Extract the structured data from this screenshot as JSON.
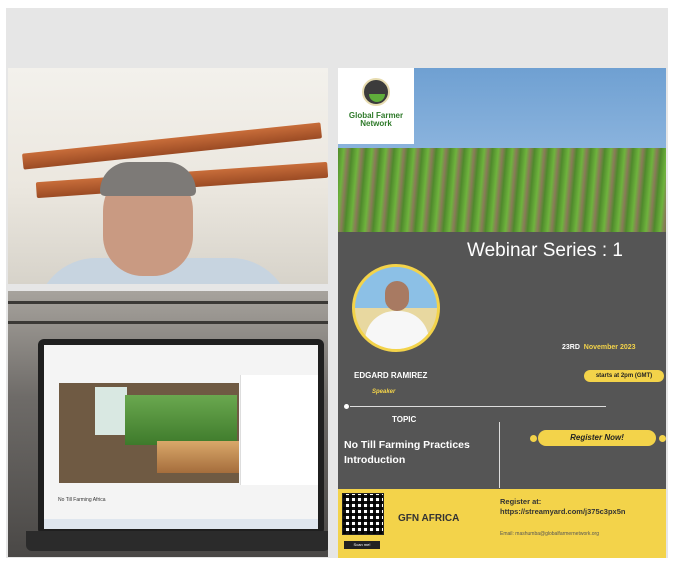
{
  "poster": {
    "logo_text_line1": "Global Farmer",
    "logo_text_line2": "Network",
    "title": "Webinar Series : 1",
    "date_day": "23RD",
    "date_rest": "November 2023",
    "speaker_name": "EDGARD RAMIREZ",
    "speaker_role": "Speaker",
    "starts_at": "starts at 2pm (GMT)",
    "topic_label": "TOPIC",
    "topic_line1": "No Till Farming Practices",
    "topic_line2": "Introduction",
    "register_button": "Register Now!",
    "org": "GFN AFRICA",
    "register_label": "Register at:",
    "register_url": "https://streamyard.com/j375c3px5n",
    "email": "Email: mashumba@globalfarmernetwork.org",
    "qr_label": "Scan me!"
  },
  "laptop": {
    "caption": "No Till Farming Africa"
  },
  "colors": {
    "accent_yellow": "#f3d34a",
    "poster_bg": "#555555",
    "logo_green": "#2f7a2a"
  }
}
